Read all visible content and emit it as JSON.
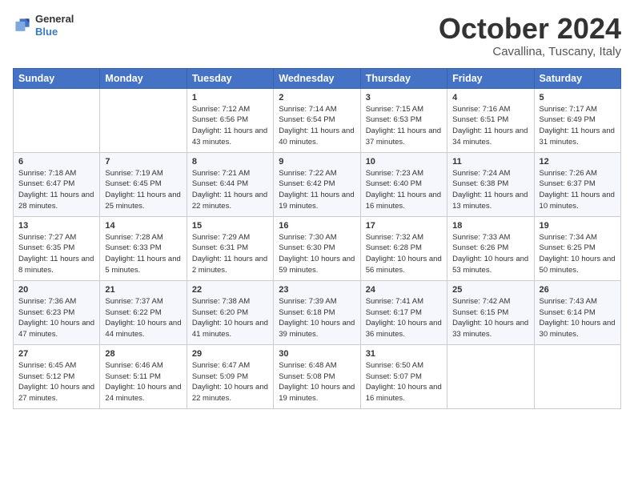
{
  "header": {
    "logo": {
      "general": "General",
      "blue": "Blue"
    },
    "title": "October 2024",
    "location": "Cavallina, Tuscany, Italy"
  },
  "weekdays": [
    "Sunday",
    "Monday",
    "Tuesday",
    "Wednesday",
    "Thursday",
    "Friday",
    "Saturday"
  ],
  "weeks": [
    [
      {
        "day": null,
        "info": null
      },
      {
        "day": null,
        "info": null
      },
      {
        "day": "1",
        "info": "Sunrise: 7:12 AM\nSunset: 6:56 PM\nDaylight: 11 hours and 43 minutes."
      },
      {
        "day": "2",
        "info": "Sunrise: 7:14 AM\nSunset: 6:54 PM\nDaylight: 11 hours and 40 minutes."
      },
      {
        "day": "3",
        "info": "Sunrise: 7:15 AM\nSunset: 6:53 PM\nDaylight: 11 hours and 37 minutes."
      },
      {
        "day": "4",
        "info": "Sunrise: 7:16 AM\nSunset: 6:51 PM\nDaylight: 11 hours and 34 minutes."
      },
      {
        "day": "5",
        "info": "Sunrise: 7:17 AM\nSunset: 6:49 PM\nDaylight: 11 hours and 31 minutes."
      }
    ],
    [
      {
        "day": "6",
        "info": "Sunrise: 7:18 AM\nSunset: 6:47 PM\nDaylight: 11 hours and 28 minutes."
      },
      {
        "day": "7",
        "info": "Sunrise: 7:19 AM\nSunset: 6:45 PM\nDaylight: 11 hours and 25 minutes."
      },
      {
        "day": "8",
        "info": "Sunrise: 7:21 AM\nSunset: 6:44 PM\nDaylight: 11 hours and 22 minutes."
      },
      {
        "day": "9",
        "info": "Sunrise: 7:22 AM\nSunset: 6:42 PM\nDaylight: 11 hours and 19 minutes."
      },
      {
        "day": "10",
        "info": "Sunrise: 7:23 AM\nSunset: 6:40 PM\nDaylight: 11 hours and 16 minutes."
      },
      {
        "day": "11",
        "info": "Sunrise: 7:24 AM\nSunset: 6:38 PM\nDaylight: 11 hours and 13 minutes."
      },
      {
        "day": "12",
        "info": "Sunrise: 7:26 AM\nSunset: 6:37 PM\nDaylight: 11 hours and 10 minutes."
      }
    ],
    [
      {
        "day": "13",
        "info": "Sunrise: 7:27 AM\nSunset: 6:35 PM\nDaylight: 11 hours and 8 minutes."
      },
      {
        "day": "14",
        "info": "Sunrise: 7:28 AM\nSunset: 6:33 PM\nDaylight: 11 hours and 5 minutes."
      },
      {
        "day": "15",
        "info": "Sunrise: 7:29 AM\nSunset: 6:31 PM\nDaylight: 11 hours and 2 minutes."
      },
      {
        "day": "16",
        "info": "Sunrise: 7:30 AM\nSunset: 6:30 PM\nDaylight: 10 hours and 59 minutes."
      },
      {
        "day": "17",
        "info": "Sunrise: 7:32 AM\nSunset: 6:28 PM\nDaylight: 10 hours and 56 minutes."
      },
      {
        "day": "18",
        "info": "Sunrise: 7:33 AM\nSunset: 6:26 PM\nDaylight: 10 hours and 53 minutes."
      },
      {
        "day": "19",
        "info": "Sunrise: 7:34 AM\nSunset: 6:25 PM\nDaylight: 10 hours and 50 minutes."
      }
    ],
    [
      {
        "day": "20",
        "info": "Sunrise: 7:36 AM\nSunset: 6:23 PM\nDaylight: 10 hours and 47 minutes."
      },
      {
        "day": "21",
        "info": "Sunrise: 7:37 AM\nSunset: 6:22 PM\nDaylight: 10 hours and 44 minutes."
      },
      {
        "day": "22",
        "info": "Sunrise: 7:38 AM\nSunset: 6:20 PM\nDaylight: 10 hours and 41 minutes."
      },
      {
        "day": "23",
        "info": "Sunrise: 7:39 AM\nSunset: 6:18 PM\nDaylight: 10 hours and 39 minutes."
      },
      {
        "day": "24",
        "info": "Sunrise: 7:41 AM\nSunset: 6:17 PM\nDaylight: 10 hours and 36 minutes."
      },
      {
        "day": "25",
        "info": "Sunrise: 7:42 AM\nSunset: 6:15 PM\nDaylight: 10 hours and 33 minutes."
      },
      {
        "day": "26",
        "info": "Sunrise: 7:43 AM\nSunset: 6:14 PM\nDaylight: 10 hours and 30 minutes."
      }
    ],
    [
      {
        "day": "27",
        "info": "Sunrise: 6:45 AM\nSunset: 5:12 PM\nDaylight: 10 hours and 27 minutes."
      },
      {
        "day": "28",
        "info": "Sunrise: 6:46 AM\nSunset: 5:11 PM\nDaylight: 10 hours and 24 minutes."
      },
      {
        "day": "29",
        "info": "Sunrise: 6:47 AM\nSunset: 5:09 PM\nDaylight: 10 hours and 22 minutes."
      },
      {
        "day": "30",
        "info": "Sunrise: 6:48 AM\nSunset: 5:08 PM\nDaylight: 10 hours and 19 minutes."
      },
      {
        "day": "31",
        "info": "Sunrise: 6:50 AM\nSunset: 5:07 PM\nDaylight: 10 hours and 16 minutes."
      },
      {
        "day": null,
        "info": null
      },
      {
        "day": null,
        "info": null
      }
    ]
  ]
}
